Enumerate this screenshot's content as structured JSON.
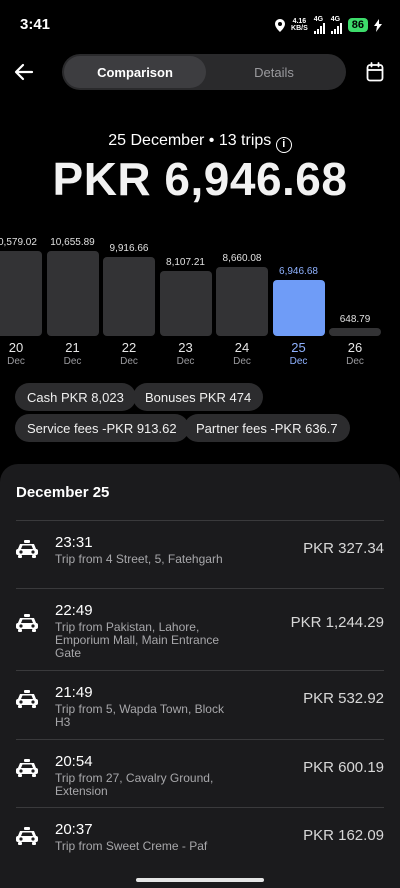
{
  "status_bar": {
    "time": "3:41",
    "net_speed_top": "4.16",
    "net_speed_bottom": "KB/S",
    "net1": "4G",
    "net2": "4G",
    "battery": "86",
    "icons": [
      "location-icon",
      "signal-icon",
      "battery-icon",
      "charging-icon"
    ]
  },
  "header": {
    "tabs": [
      {
        "label": "Comparison",
        "active": true
      },
      {
        "label": "Details",
        "active": false
      }
    ]
  },
  "summary": {
    "date": "25 December",
    "separator": "•",
    "trips": "13 trips",
    "info": "i",
    "total": "PKR 6,946.68"
  },
  "chart_data": {
    "type": "bar",
    "categories": [
      "20",
      "21",
      "22",
      "23",
      "24",
      "25",
      "26"
    ],
    "months": [
      "Dec",
      "Dec",
      "Dec",
      "Dec",
      "Dec",
      "Dec",
      "Dec"
    ],
    "values": [
      10579.02,
      10655.89,
      9916.66,
      8107.21,
      8660.08,
      6946.68,
      648.79
    ],
    "value_labels": [
      "0,579.02",
      "10,655.89",
      "9,916.66",
      "8,107.21",
      "8,660.08",
      "6,946.68",
      "648.79"
    ],
    "selected_index": 5,
    "ylim": [
      0,
      11000
    ],
    "colors": {
      "bar": "#333335",
      "selected": "#6f9cf7"
    }
  },
  "chips": [
    "Cash PKR 8,023",
    "Bonuses PKR 474",
    "Service fees -PKR 913.62",
    "Partner fees -PKR 636.7"
  ],
  "trips_list": {
    "title": "December 25",
    "items": [
      {
        "time": "23:31",
        "desc": "Trip from 4 Street, 5, Fatehgarh",
        "amount": "PKR 327.34"
      },
      {
        "time": "22:49",
        "desc": "Trip from Pakistan, Lahore, Emporium Mall, Main Entrance Gate",
        "amount": "PKR 1,244.29"
      },
      {
        "time": "21:49",
        "desc": "Trip from 5, Wapda Town, Block H3",
        "amount": "PKR 532.92"
      },
      {
        "time": "20:54",
        "desc": "Trip from 27, Cavalry Ground, Extension",
        "amount": "PKR 600.19"
      },
      {
        "time": "20:37",
        "desc": "Trip from Sweet Creme - Paf",
        "amount": "PKR 162.09"
      }
    ]
  },
  "colors": {
    "accent": "#6f9cf7",
    "battery": "#3ddc6b"
  }
}
